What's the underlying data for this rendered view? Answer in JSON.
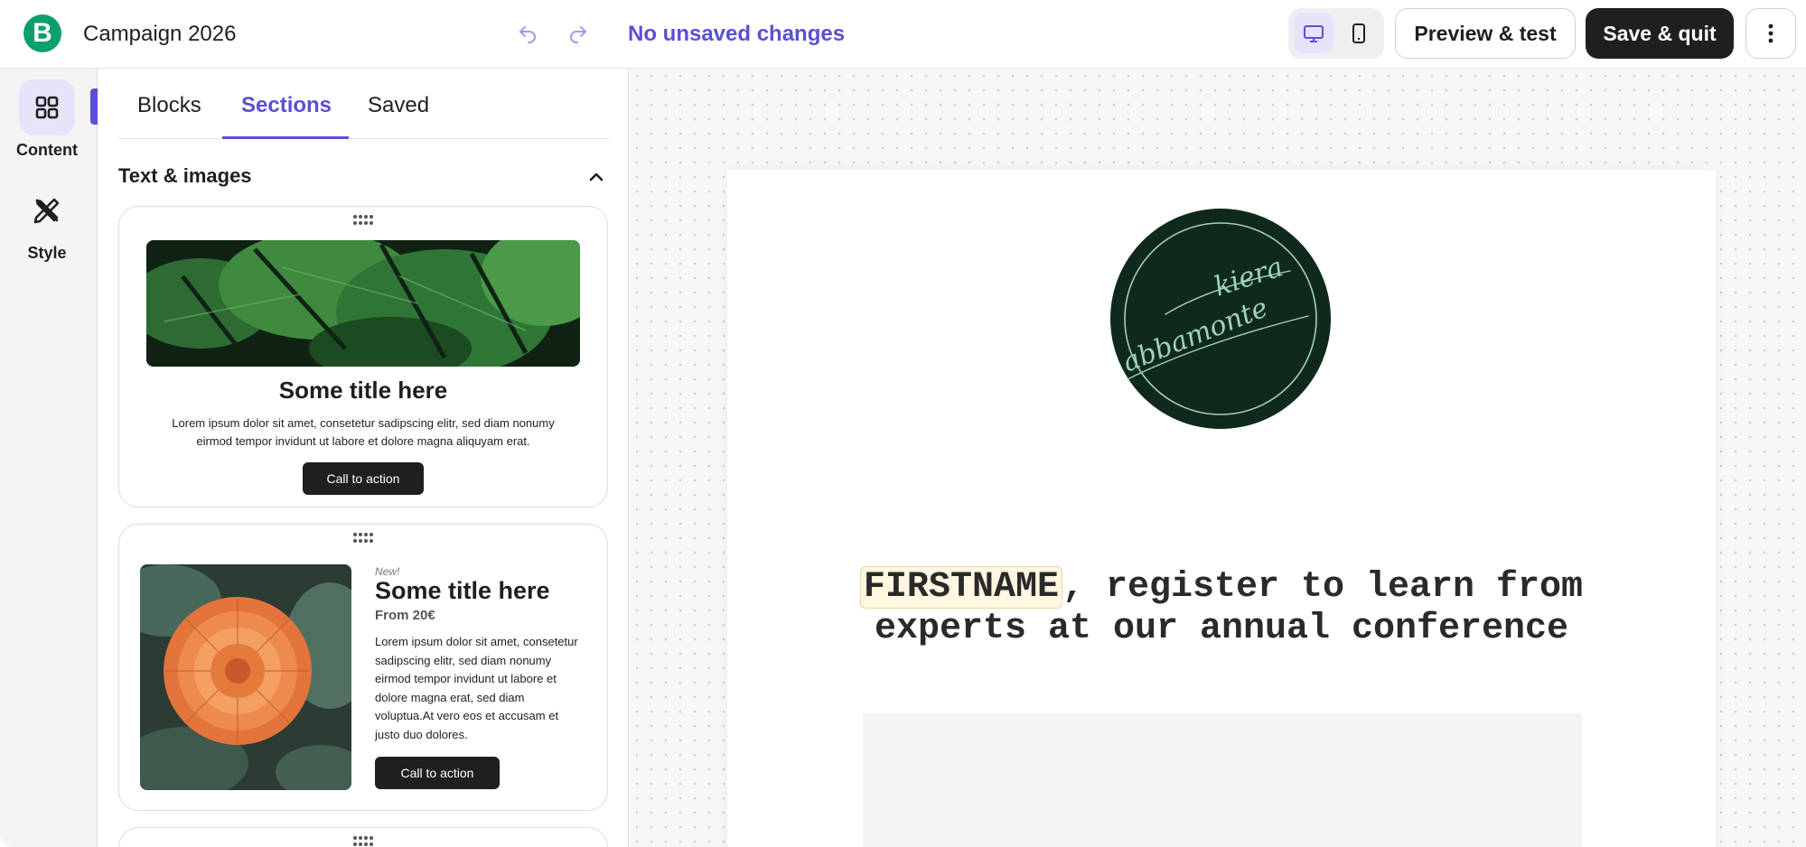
{
  "header": {
    "logo_letter": "B",
    "campaign_title": "Campaign 2026",
    "save_status": "No unsaved changes",
    "preview_label": "Preview & test",
    "save_quit_label": "Save & quit",
    "accent_color": "#5b4fd6"
  },
  "rail": {
    "items": [
      {
        "label": "Content",
        "icon": "grid-icon",
        "active": true
      },
      {
        "label": "Style",
        "icon": "pen-ruler-icon",
        "active": false
      }
    ]
  },
  "panel": {
    "tabs": [
      {
        "label": "Blocks",
        "active": false
      },
      {
        "label": "Sections",
        "active": true
      },
      {
        "label": "Saved",
        "active": false
      }
    ],
    "section_heading": "Text & images",
    "cards": [
      {
        "image": "monstera-leaves-photo",
        "title": "Some title here",
        "body": "Lorem ipsum dolor sit amet, consetetur sadipscing elitr, sed diam nonumy eirmod tempor invidunt ut labore et dolore magna aliquyam erat.",
        "cta": "Call to action"
      },
      {
        "image": "orange-dahlia-photo",
        "eyebrow": "New!",
        "title": "Some title here",
        "price": "From 20€",
        "body": "Lorem ipsum dolor sit amet, consetetur sadipscing elitr, sed diam nonumy eirmod tempor invidunt ut labore et dolore magna erat, sed diam voluptua.At vero eos et accusam et justo duo dolores.",
        "cta": "Call to action"
      }
    ]
  },
  "email": {
    "logo_text_line1": "kiera",
    "logo_text_line2": "abbamonte",
    "logo_color": "#0f2a1c",
    "merge_tag": "FIRSTNAME",
    "headline_rest": ", register to learn from experts at our annual conference"
  }
}
